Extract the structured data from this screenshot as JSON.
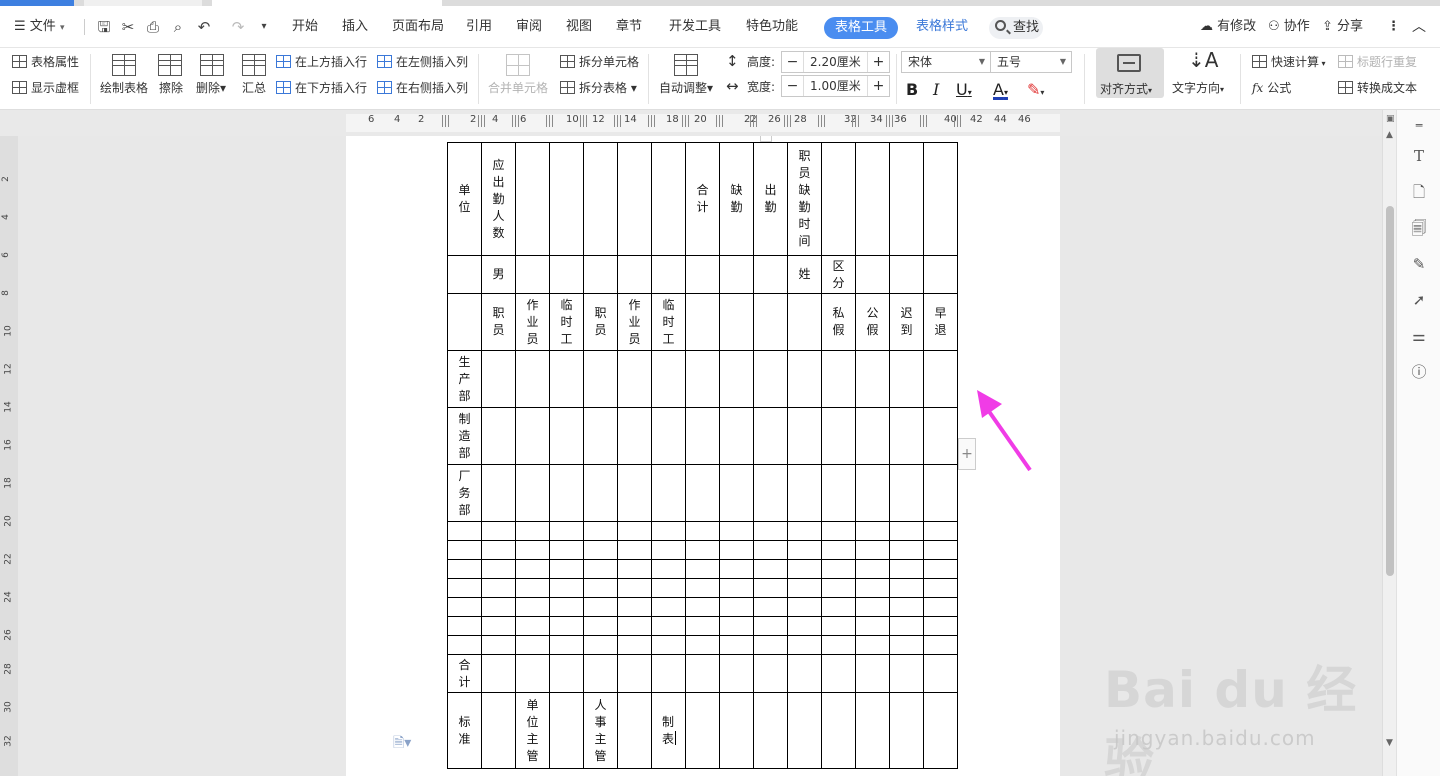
{
  "menubar": {
    "file": "文件",
    "tabs": [
      "开始",
      "插入",
      "页面布局",
      "引用",
      "审阅",
      "视图",
      "章节",
      "开发工具",
      "特色功能"
    ],
    "active_tab": "表格工具",
    "style_tab": "表格样式",
    "search": "查找",
    "has_changes": "有修改",
    "collaborate": "协作",
    "share": "分享"
  },
  "ribbon": {
    "table_props": "表格属性",
    "show_grid": "显示虚框",
    "draw_table": "绘制表格",
    "erase": "擦除",
    "delete": "删除",
    "summary": "汇总",
    "insert_above": "在上方插入行",
    "insert_below": "在下方插入行",
    "insert_left": "在左侧插入列",
    "insert_right": "在右侧插入列",
    "merge_cells": "合并单元格",
    "split_cells": "拆分单元格",
    "split_table": "拆分表格",
    "auto_adjust": "自动调整",
    "height_label": "高度:",
    "height_value": "2.20厘米",
    "width_label": "宽度:",
    "width_value": "1.00厘米",
    "font_name": "宋体",
    "font_size": "五号",
    "align": "对齐方式",
    "text_direction": "文字方向",
    "quick_calc": "快速计算",
    "formula": "公式",
    "repeat_header": "标题行重复",
    "to_text": "转换成文本",
    "colors": {
      "font_color": "#1f3fb4",
      "highlight": "#e03030",
      "accent": "#4a8df0"
    }
  },
  "ruler": {
    "numbers": [
      "6",
      "4",
      "2",
      "2",
      "4",
      "6",
      "10",
      "12",
      "14",
      "18",
      "20",
      "22",
      "26",
      "28",
      "32",
      "34",
      "36",
      "40",
      "42",
      "44",
      "46"
    ]
  },
  "vruler": {
    "numbers": [
      "2",
      "4",
      "6",
      "8",
      "10",
      "12",
      "14",
      "16",
      "18",
      "20",
      "22",
      "24",
      "26",
      "28",
      "30",
      "32"
    ]
  },
  "table": {
    "header1": {
      "unit": "单位",
      "should_attend": "应出勤人数",
      "total": "合计",
      "absent": "缺勤",
      "present": "出勤",
      "absence_time": "职员缺勤时间"
    },
    "header2": {
      "male": "男",
      "name": "姓",
      "category": "区分"
    },
    "header3": {
      "staff1": "职员",
      "worker1": "作业员",
      "temp1": "临时工",
      "staff2": "职员",
      "worker2": "作业员",
      "temp2": "临时工",
      "personal_leave": "私假",
      "public_leave": "公假",
      "late": "迟到",
      "early_leave": "早退"
    },
    "departments": [
      "生产部",
      "制造部",
      "厂务部"
    ],
    "total_row": "合计",
    "footer": {
      "standard": "标准",
      "unit_supervisor": "单位主管",
      "hr_supervisor": "人事主管",
      "prepared_by": "制表"
    }
  },
  "watermark": {
    "brand": "Bai du 经验",
    "url": "jingyan.baidu.com"
  }
}
